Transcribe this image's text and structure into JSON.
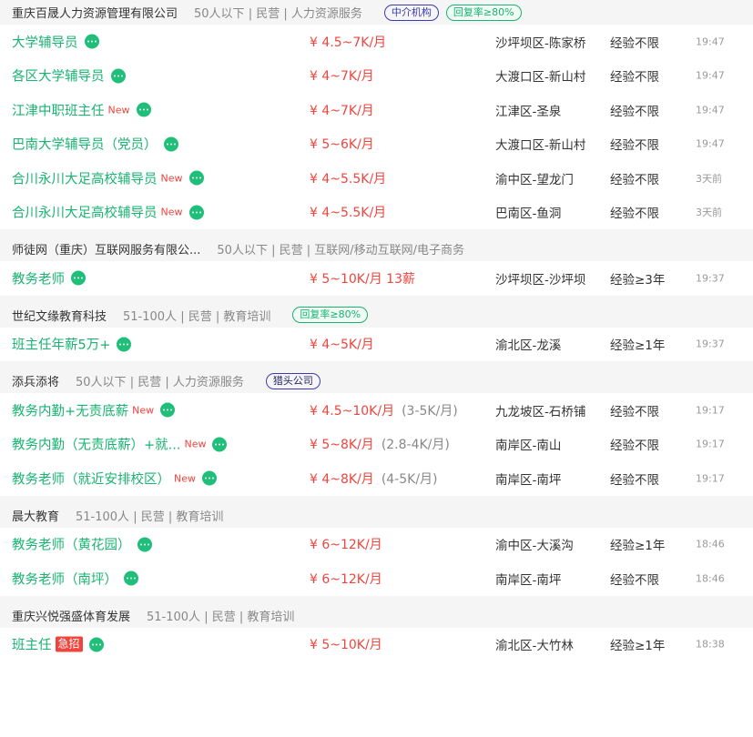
{
  "groups": [
    {
      "company": "重庆百晟人力资源管理有限公司",
      "meta": "50人以下 | 民营 | 人力资源服务",
      "tags": [
        {
          "text": "中介机构",
          "kind": "agency"
        },
        {
          "text": "回复率≥80%",
          "kind": "reply"
        }
      ],
      "jobs": [
        {
          "title": "大学辅导员",
          "new": "",
          "urgent": "",
          "salary": "¥ 4.5~7K/月",
          "extra": "",
          "location": "沙坪坝区-陈家桥",
          "experience": "经验不限",
          "time": "19:47"
        },
        {
          "title": "各区大学辅导员",
          "new": "",
          "urgent": "",
          "salary": "¥ 4~7K/月",
          "extra": "",
          "location": "大渡口区-新山村",
          "experience": "经验不限",
          "time": "19:47"
        },
        {
          "title": "江津中职班主任",
          "new": "New",
          "urgent": "",
          "salary": "¥ 4~7K/月",
          "extra": "",
          "location": "江津区-圣泉",
          "experience": "经验不限",
          "time": "19:47"
        },
        {
          "title": "巴南大学辅导员（党员）",
          "new": "",
          "urgent": "",
          "salary": "¥ 5~6K/月",
          "extra": "",
          "location": "大渡口区-新山村",
          "experience": "经验不限",
          "time": "19:47"
        },
        {
          "title": "合川永川大足高校辅导员",
          "new": "New",
          "urgent": "",
          "salary": "¥ 4~5.5K/月",
          "extra": "",
          "location": "渝中区-望龙门",
          "experience": "经验不限",
          "time": "3天前"
        },
        {
          "title": "合川永川大足高校辅导员",
          "new": "New",
          "urgent": "",
          "salary": "¥ 4~5.5K/月",
          "extra": "",
          "location": "巴南区-鱼洞",
          "experience": "经验不限",
          "time": "3天前"
        }
      ]
    },
    {
      "company": "师徒网（重庆）互联网服务有限公...",
      "meta": "50人以下 | 民营 | 互联网/移动互联网/电子商务",
      "tags": [],
      "jobs": [
        {
          "title": "教务老师",
          "new": "",
          "urgent": "",
          "salary": "¥ 5~10K/月 13薪",
          "extra": "",
          "location": "沙坪坝区-沙坪坝",
          "experience": "经验≥3年",
          "time": "19:37"
        }
      ]
    },
    {
      "company": "世纪文缘教育科技",
      "meta": "51-100人 | 民营 | 教育培训",
      "tags": [
        {
          "text": "回复率≥80%",
          "kind": "reply"
        }
      ],
      "jobs": [
        {
          "title": "班主任年薪5万+",
          "new": "",
          "urgent": "",
          "salary": "¥ 4~5K/月",
          "extra": "",
          "location": "渝北区-龙溪",
          "experience": "经验≥1年",
          "time": "19:37"
        }
      ]
    },
    {
      "company": "添兵添将",
      "meta": "50人以下 | 民营 | 人力资源服务",
      "tags": [
        {
          "text": "猎头公司",
          "kind": "headhunt"
        }
      ],
      "jobs": [
        {
          "title": "教务内勤+无责底薪",
          "new": "New",
          "urgent": "",
          "salary": "¥ 4.5~10K/月",
          "extra": "(3-5K/月)",
          "location": "九龙坡区-石桥铺",
          "experience": "经验不限",
          "time": "19:17"
        },
        {
          "title": "教务内勤（无责底薪）+就...",
          "new": "New",
          "urgent": "",
          "salary": "¥ 5~8K/月",
          "extra": "(2.8-4K/月)",
          "location": "南岸区-南山",
          "experience": "经验不限",
          "time": "19:17"
        },
        {
          "title": "教务老师（就近安排校区）",
          "new": "New",
          "urgent": "",
          "salary": "¥ 4~8K/月",
          "extra": "(4-5K/月)",
          "location": "南岸区-南坪",
          "experience": "经验不限",
          "time": "19:17"
        }
      ]
    },
    {
      "company": "晨大教育",
      "meta": "51-100人 | 民营 | 教育培训",
      "tags": [],
      "jobs": [
        {
          "title": "教务老师（黄花园）",
          "new": "",
          "urgent": "",
          "salary": "¥ 6~12K/月",
          "extra": "",
          "location": "渝中区-大溪沟",
          "experience": "经验≥1年",
          "time": "18:46"
        },
        {
          "title": "教务老师（南坪）",
          "new": "",
          "urgent": "",
          "salary": "¥ 6~12K/月",
          "extra": "",
          "location": "南岸区-南坪",
          "experience": "经验不限",
          "time": "18:46"
        }
      ]
    },
    {
      "company": "重庆兴悦强盛体育发展",
      "meta": "51-100人 | 民营 | 教育培训",
      "tags": [],
      "jobs": [
        {
          "title": "班主任",
          "new": "",
          "urgent": "急招",
          "salary": "¥ 5~10K/月",
          "extra": "",
          "location": "渝北区-大竹林",
          "experience": "经验≥1年",
          "time": "18:38"
        }
      ]
    }
  ]
}
